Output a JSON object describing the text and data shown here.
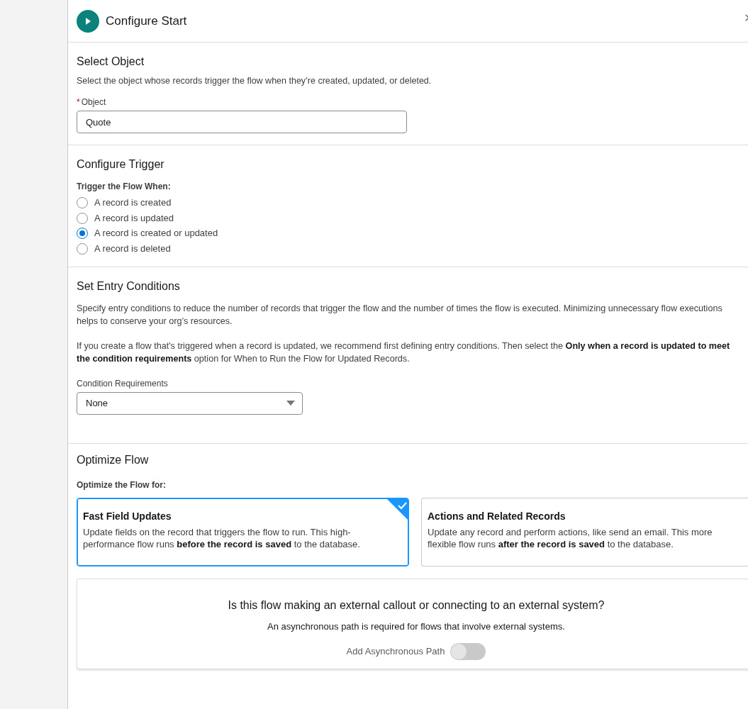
{
  "panel": {
    "title": "Configure Start"
  },
  "select_object": {
    "title": "Select Object",
    "description": "Select the object whose records trigger the flow when they’re created, updated, or deleted.",
    "object_field": {
      "required_mark": "*",
      "label": "Object",
      "value": "Quote"
    }
  },
  "configure_trigger": {
    "title": "Configure Trigger",
    "group_label": "Trigger the Flow When:",
    "options": [
      {
        "label": "A record is created",
        "selected": false
      },
      {
        "label": "A record is updated",
        "selected": false
      },
      {
        "label": "A record is created or updated",
        "selected": true
      },
      {
        "label": "A record is deleted",
        "selected": false
      }
    ]
  },
  "entry_conditions": {
    "title": "Set Entry Conditions",
    "paragraphs": [
      "Specify entry conditions to reduce the number of records that trigger the flow and the number of times the flow is executed. Minimizing unnecessary flow executions helps to conserve your org’s resources.",
      "If you create a flow that's triggered when a record is updated, we recommend first defining entry conditions. Then select the **Only when a record is updated to meet the condition requirements** option for When to Run the Flow for Updated Records."
    ],
    "condition_field": {
      "label": "Condition Requirements",
      "value": "None"
    }
  },
  "optimize_flow": {
    "title": "Optimize Flow",
    "group_label": "Optimize the Flow for:",
    "options": [
      {
        "title": "Fast Field Updates",
        "description": "Update fields on the record that triggers the flow to run. This high-performance flow runs **before the record is saved** to the database.",
        "selected": true
      },
      {
        "title": "Actions and Related Records",
        "description": "Update any record and perform actions, like send an email. This more flexible flow runs **after the record is saved** to the database.",
        "selected": false
      }
    ],
    "callout": {
      "question": "Is this flow making an external callout or connecting to an external system?",
      "note": "An asynchronous path is required for flows that involve external systems.",
      "toggle": {
        "label": "Add Asynchronous Path",
        "on": false
      }
    }
  }
}
